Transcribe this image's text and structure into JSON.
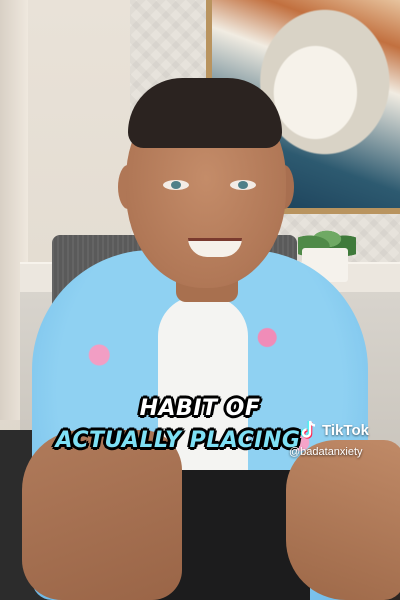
{
  "caption": {
    "line1": "HABIT OF",
    "line2": "ACTUALLY PLACING"
  },
  "watermark": {
    "brand": "TikTok",
    "handle": "@badatanxiety",
    "icon": "tiktok-logo-icon"
  },
  "colors": {
    "caption_primary": "#ffffff",
    "caption_accent": "#7ee0f5"
  }
}
